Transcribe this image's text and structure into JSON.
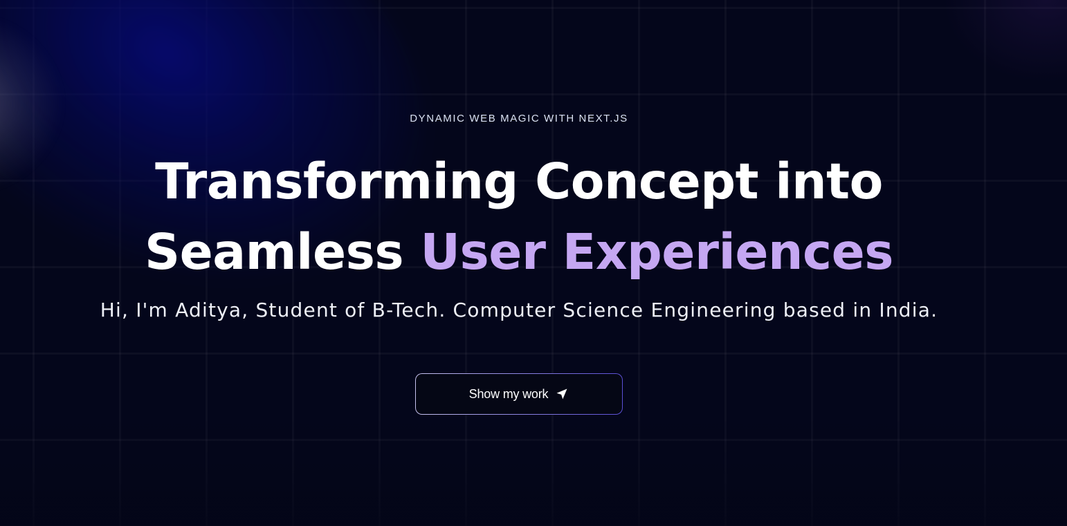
{
  "hero": {
    "eyebrow": "DYNAMIC WEB MAGIC WITH NEXT.JS",
    "headline_line1": "Transforming Concept into",
    "headline_line2_plain": "Seamless",
    "headline_line2_accent": "User Experiences",
    "subtitle": "Hi, I'm Aditya, Student of B-Tech. Computer Science Engineering based in India.",
    "cta_label": "Show my work",
    "cta_icon": "location-arrow-icon"
  },
  "colors": {
    "background": "#04061b",
    "accent_text": "#c5a7f2",
    "glow_blue": "#060a78",
    "button_border_start": "#c7c3ef",
    "button_border_end": "#5b4fd6"
  }
}
